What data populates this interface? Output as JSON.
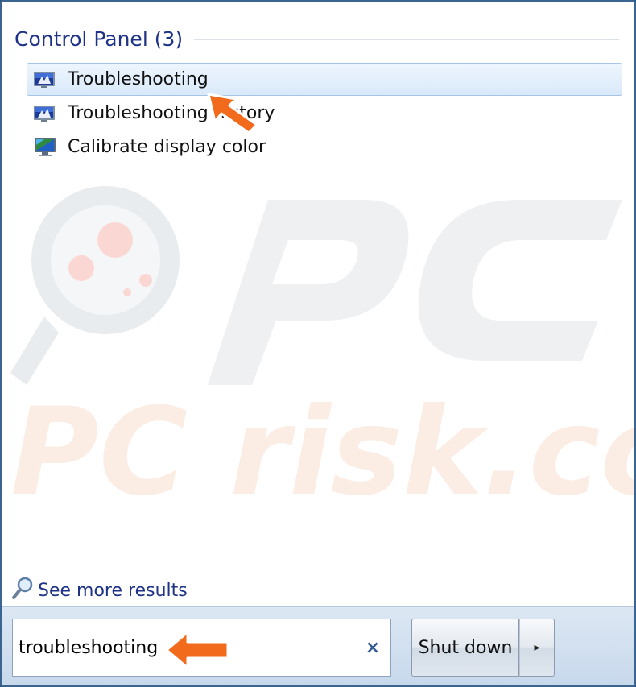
{
  "group": {
    "title": "Control Panel (3)"
  },
  "results": [
    {
      "label": "Troubleshooting",
      "icon": "troubleshooting-icon",
      "selected": true
    },
    {
      "label": "Troubleshooting history",
      "icon": "troubleshooting-history-icon",
      "selected": false
    },
    {
      "label": "Calibrate display color",
      "icon": "display-color-icon",
      "selected": false
    }
  ],
  "more_results": {
    "label": "See more results",
    "icon": "magnifier-icon"
  },
  "search": {
    "value": "troubleshooting"
  },
  "shutdown": {
    "label": "Shut down",
    "arrow": "▸"
  },
  "clear_glyph": "×",
  "watermark": {
    "text": "PC risk.com"
  },
  "colors": {
    "accent": "#1e3287",
    "selection_border": "#a6c4e6",
    "annotation_arrow": "#f26a1b"
  }
}
